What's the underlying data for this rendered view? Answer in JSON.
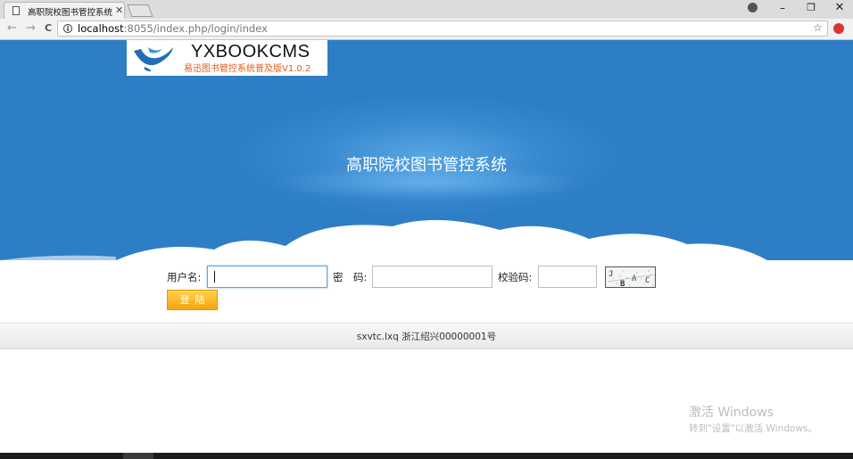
{
  "browser": {
    "tab_title": "高职院校图书管控系统",
    "url_host": "localhost",
    "url_rest": ":8055/index.php/login/index",
    "nav": {
      "back": "←",
      "forward": "→",
      "reload": "C"
    },
    "star": "☆",
    "window": {
      "minimize": "–",
      "restore": "❐",
      "close": "✕"
    }
  },
  "logo": {
    "name": "YXBOOKCMS",
    "subtitle": "易迅图书管控系统普及版V1.0.2"
  },
  "banner": {
    "title": "高职院校图书管控系统"
  },
  "form": {
    "username_label": "用户名:",
    "username_value": "",
    "password_label": "密　码:",
    "password_value": "",
    "captcha_label": "校验码:",
    "captcha_value": "",
    "captcha_image_text": "JBAC",
    "login_label": "登陆"
  },
  "footer": {
    "text": "sxvtc.lxq  浙江绍兴00000001号"
  },
  "watermark": {
    "title": "激活 Windows",
    "subtitle": "转到\"设置\"以激活 Windows。"
  },
  "colors": {
    "banner": "#2e7ec5",
    "login_button": "#f7a411",
    "logo_subtitle": "#e05a1a"
  }
}
